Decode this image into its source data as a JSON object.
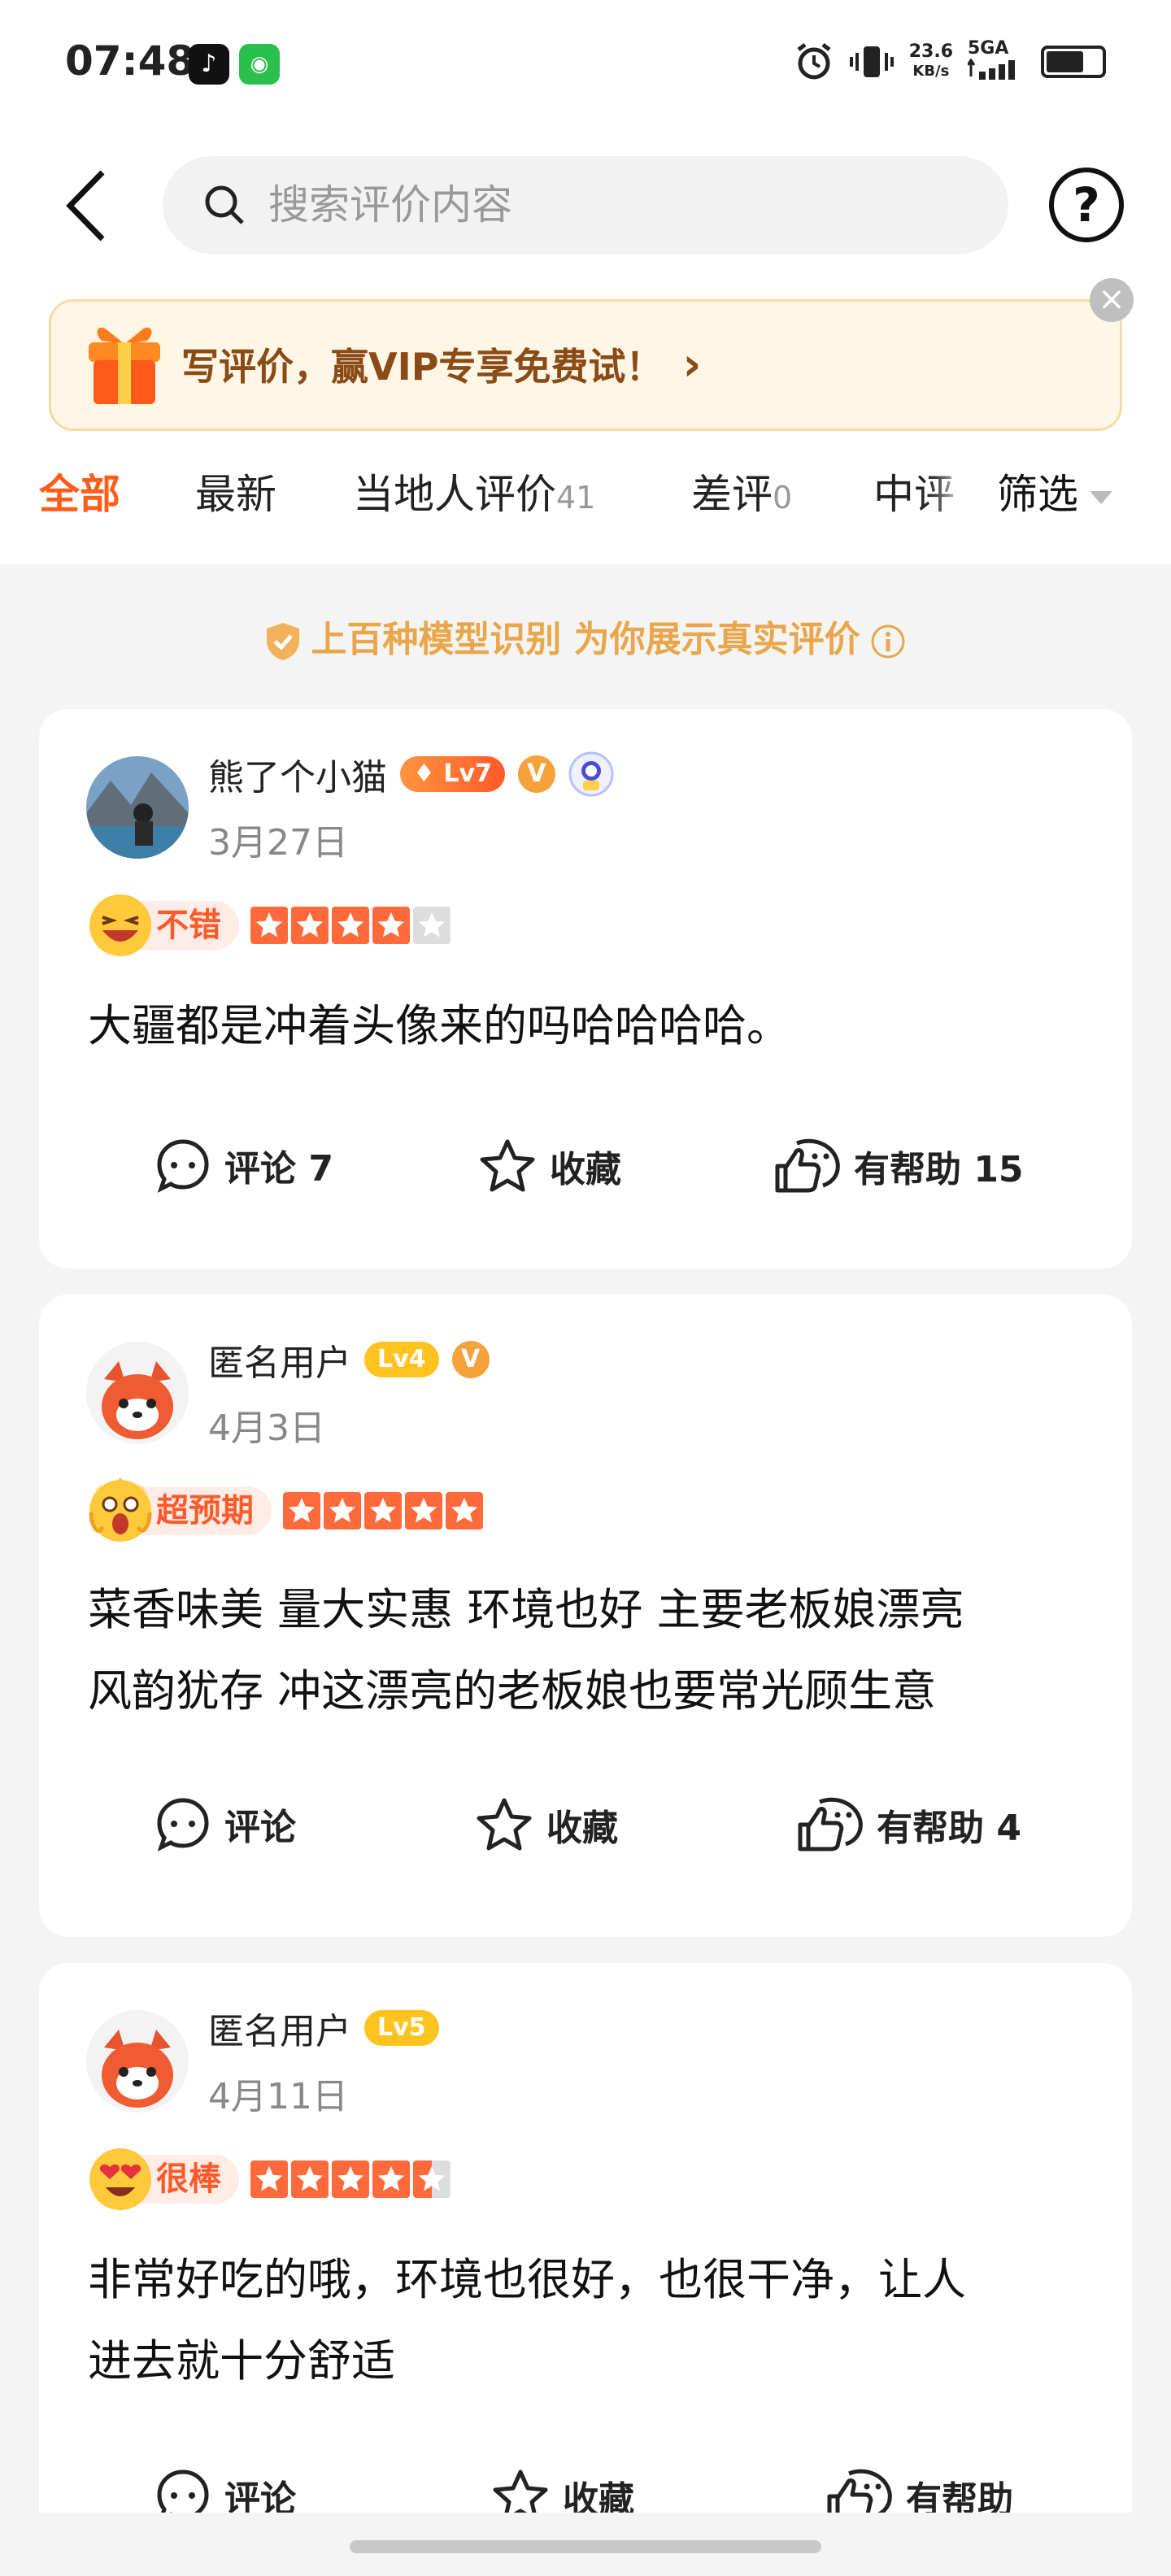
{
  "status_bar": {
    "time": "07:48",
    "net_speed": "23.6",
    "net_unit": "KB/s",
    "network": "5GA"
  },
  "search": {
    "placeholder": "搜索评价内容"
  },
  "promo": {
    "text": "写评价，赢VIP专享免费试！",
    "arrow": "›",
    "close": "×"
  },
  "tabs": [
    {
      "label": "全部",
      "count": ""
    },
    {
      "label": "最新",
      "count": ""
    },
    {
      "label": "当地人评价",
      "count": "41"
    },
    {
      "label": "差评",
      "count": "0"
    },
    {
      "label": "中评",
      "count": ""
    }
  ],
  "filter_label": "筛选",
  "trust_text": "上百种模型识别 为你展示真实评价",
  "reviews": [
    {
      "user": "熊了个小猫",
      "level": "Lv7",
      "verified": "V",
      "date": "3月27日",
      "rating_label": "不错",
      "stars": 4,
      "text": [
        "大疆都是冲着头像来的吗哈哈哈哈。"
      ],
      "comment": "评论 7",
      "favorite": "收藏",
      "helpful": "有帮助 15"
    },
    {
      "user": "匿名用户",
      "level": "Lv4",
      "verified": "V",
      "date": "4月3日",
      "rating_label": "超预期",
      "stars": 5,
      "text": [
        "菜香味美 量大实惠 环境也好 主要老板娘漂亮",
        "风韵犹存 冲这漂亮的老板娘也要常光顾生意"
      ],
      "comment": "评论",
      "favorite": "收藏",
      "helpful": "有帮助 4"
    },
    {
      "user": "匿名用户",
      "level": "Lv5",
      "verified": "",
      "date": "4月11日",
      "rating_label": "很棒",
      "stars": 4.5,
      "text": [
        "非常好吃的哦，环境也很好，也很干净，让人",
        "进去就十分舒适"
      ],
      "comment": "评论",
      "favorite": "收藏",
      "helpful": "有帮助"
    }
  ],
  "colors": {
    "accent": "#ff5e1a",
    "star": "#ff6a3d",
    "star_empty": "#dddddd",
    "trust": "#e9a64a",
    "level_red": "#ff5a2a",
    "level_gold": "#ffc21f"
  }
}
